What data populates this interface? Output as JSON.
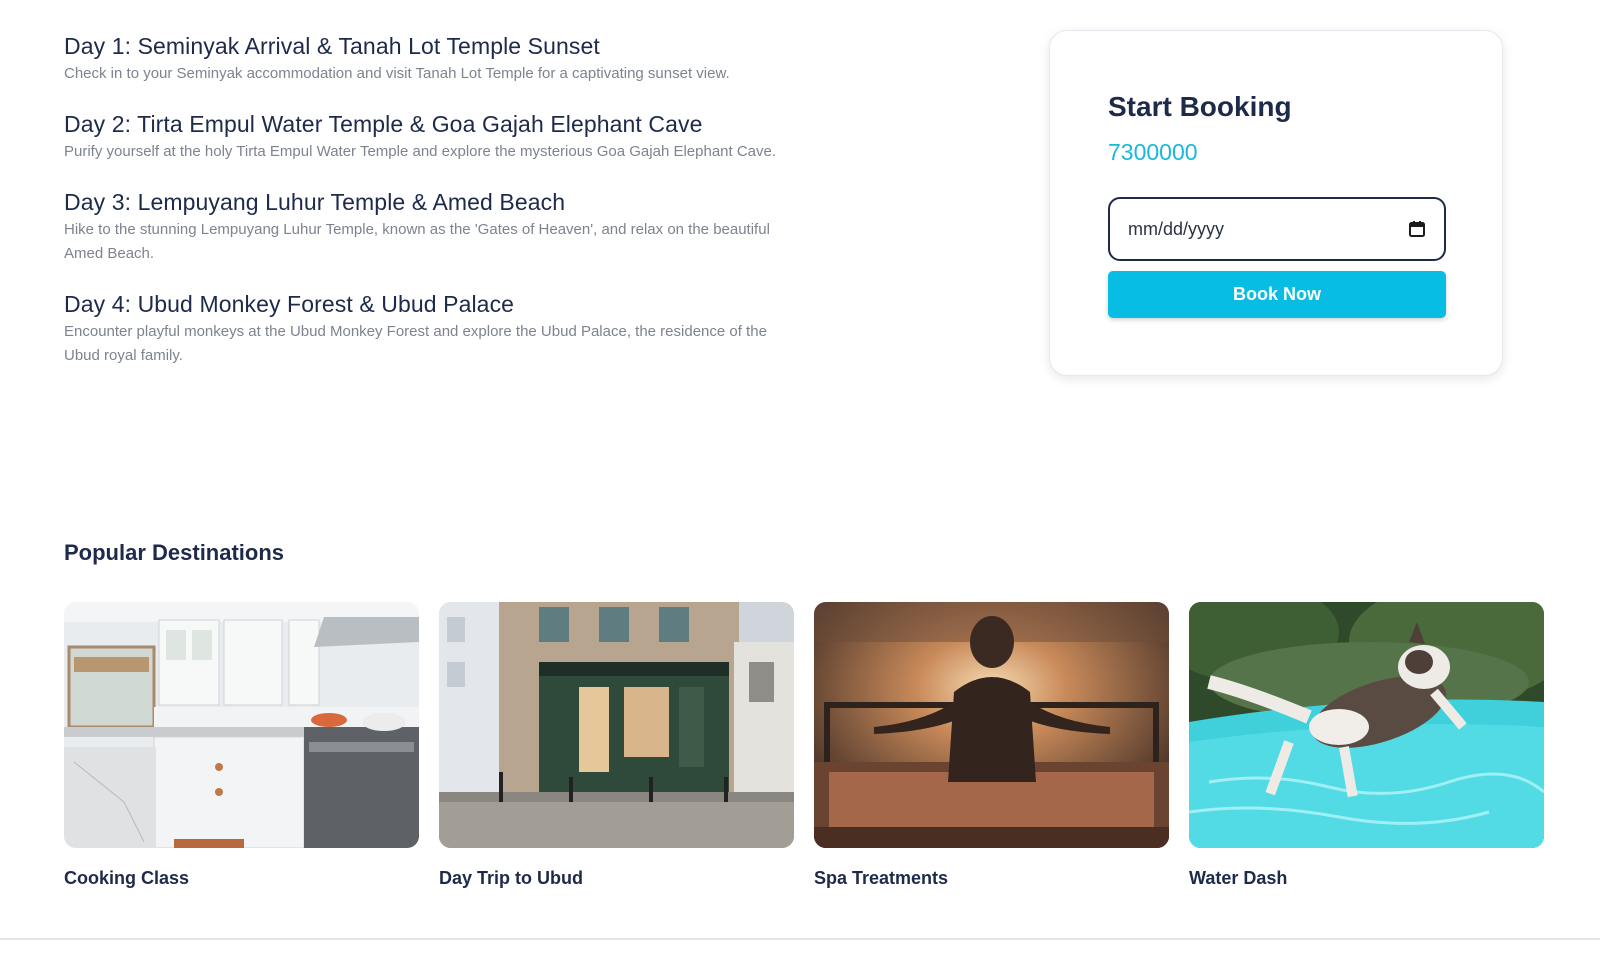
{
  "itinerary": {
    "days": [
      {
        "title": "Day 1: Seminyak Arrival & Tanah Lot Temple Sunset",
        "description": "Check in to your Seminyak accommodation and visit Tanah Lot Temple for a captivating sunset view."
      },
      {
        "title": "Day 2: Tirta Empul Water Temple & Goa Gajah Elephant Cave",
        "description": "Purify yourself at the holy Tirta Empul Water Temple and explore the mysterious Goa Gajah Elephant Cave."
      },
      {
        "title": "Day 3: Lempuyang Luhur Temple & Amed Beach",
        "description": "Hike to the stunning Lempuyang Luhur Temple, known as the 'Gates of Heaven', and relax on the beautiful Amed Beach."
      },
      {
        "title": "Day 4: Ubud Monkey Forest & Ubud Palace",
        "description": "Encounter playful monkeys at the Ubud Monkey Forest and explore the Ubud Palace, the residence of the Ubud royal family."
      }
    ]
  },
  "booking": {
    "title": "Start Booking",
    "price": "7300000",
    "date_placeholder": "mm/dd/yyyy",
    "button_label": "Book Now",
    "colors": {
      "accent": "#07bde3",
      "price": "#18b8dc",
      "text": "#1e2a4a"
    }
  },
  "destinations": {
    "title": "Popular Destinations",
    "items": [
      {
        "label": "Cooking Class",
        "image": "kitchen-photo"
      },
      {
        "label": "Day Trip to Ubud",
        "image": "street-shop-photo"
      },
      {
        "label": "Spa Treatments",
        "image": "meditation-sunset-photo"
      },
      {
        "label": "Water Dash",
        "image": "dog-pool-photo"
      }
    ]
  }
}
